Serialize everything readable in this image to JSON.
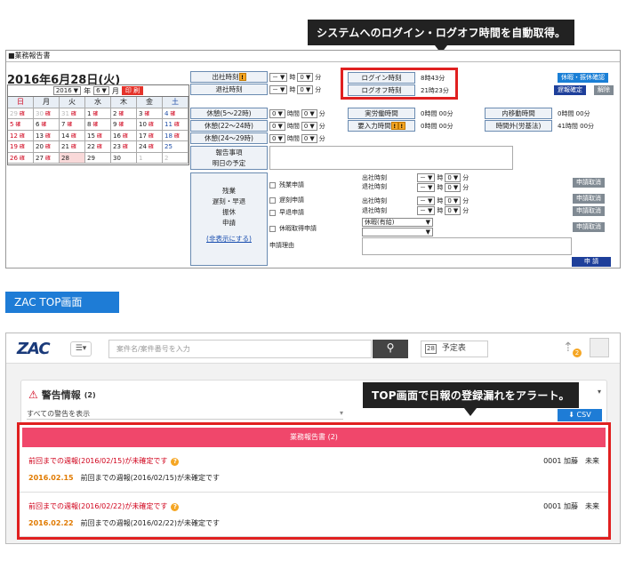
{
  "callout_login": "システムへのログイン・ログオフ時間を自動取得。",
  "callout_top": "TOP画面で日報の登録漏れをアラート。",
  "panel1": {
    "title": "■業務報告書",
    "date_heading": "2016年6月28日(火)",
    "cal_year": "2016",
    "cal_year_label": "年",
    "cal_month": "6",
    "cal_month_label": "月",
    "print_label": "印 刷",
    "weekdays": [
      "日",
      "月",
      "火",
      "水",
      "木",
      "金",
      "土"
    ],
    "weeks": [
      [
        "29",
        "30",
        "31",
        "1",
        "2",
        "3",
        "4"
      ],
      [
        "5",
        "6",
        "7",
        "8",
        "9",
        "10",
        "11"
      ],
      [
        "12",
        "13",
        "14",
        "15",
        "16",
        "17",
        "18"
      ],
      [
        "19",
        "20",
        "21",
        "22",
        "23",
        "24",
        "25"
      ],
      [
        "26",
        "27",
        "28",
        "29",
        "30",
        "1",
        "2"
      ]
    ],
    "cal_mark": "確",
    "attend_in": "出社時刻",
    "attend_out": "退社時刻",
    "dash": "－",
    "hour_unit": "時",
    "min_unit": "分",
    "zero": "0",
    "hour_unit_long": "時間",
    "login_label": "ログイン時刻",
    "login_value": "8時43分",
    "logoff_label": "ログオフ時刻",
    "logoff_value": "21時23分",
    "btn_holiday_confirm": "休暇・振休確認",
    "btn_overtime_confirm": "遅報確定",
    "btn_release": "解除",
    "break1": "休憩(5～22時)",
    "break2": "休憩(22～24時)",
    "break3": "休憩(24～29時)",
    "actual_label": "実労働時間",
    "actual_value": "0時間 00分",
    "entered_label": "要入力時間",
    "entered_value": "0時間 00分",
    "internal_label": "内移動時間",
    "internal_value": "0時間 00分",
    "outside_label": "時間外(労基法)",
    "outside_value": "41時間 00分",
    "report_label_1": "報告事項",
    "report_label_2": "明日の予定",
    "req_label_1": "残業",
    "req_label_2": "遅刻・早退",
    "req_label_3": "振休",
    "req_label_4": "申請",
    "hide_link": "(非表示にする)",
    "chk_overtime": "残業申請",
    "chk_late": "遅刻申請",
    "chk_early": "早退申請",
    "chk_holiday": "休暇取得申請",
    "reason_label": "申請理由",
    "holiday_type": "休暇(有給)",
    "btn_cancel": "申請取消",
    "btn_apply": "申 請"
  },
  "zac_tag": "ZAC TOP画面",
  "panel2": {
    "logo": "ZAC",
    "search_placeholder": "案件名/案件番号を入力",
    "calendar_num": "28",
    "schedule_label": "予定表",
    "notify_count": "2",
    "warn_title": "警告情報",
    "warn_count": "(2)",
    "filter_value": "すべての警告を表示",
    "csv_label": "CSV",
    "section_title": "業務報告書",
    "section_count": "(2)",
    "alerts": [
      {
        "link": "前回までの週報(2016/02/15)が未確定です",
        "user": "0001 加藤",
        "status": "未来",
        "date": "2016.02.15",
        "desc": "前回までの週報(2016/02/15)が未確定です"
      },
      {
        "link": "前回までの週報(2016/02/22)が未確定です",
        "user": "0001 加藤",
        "status": "未来",
        "date": "2016.02.22",
        "desc": "前回までの週報(2016/02/22)が未確定です"
      }
    ]
  },
  "colors": {
    "accent_blue": "#1e7cd6",
    "alert_red": "#e02020",
    "section_pink": "#f0476b"
  }
}
